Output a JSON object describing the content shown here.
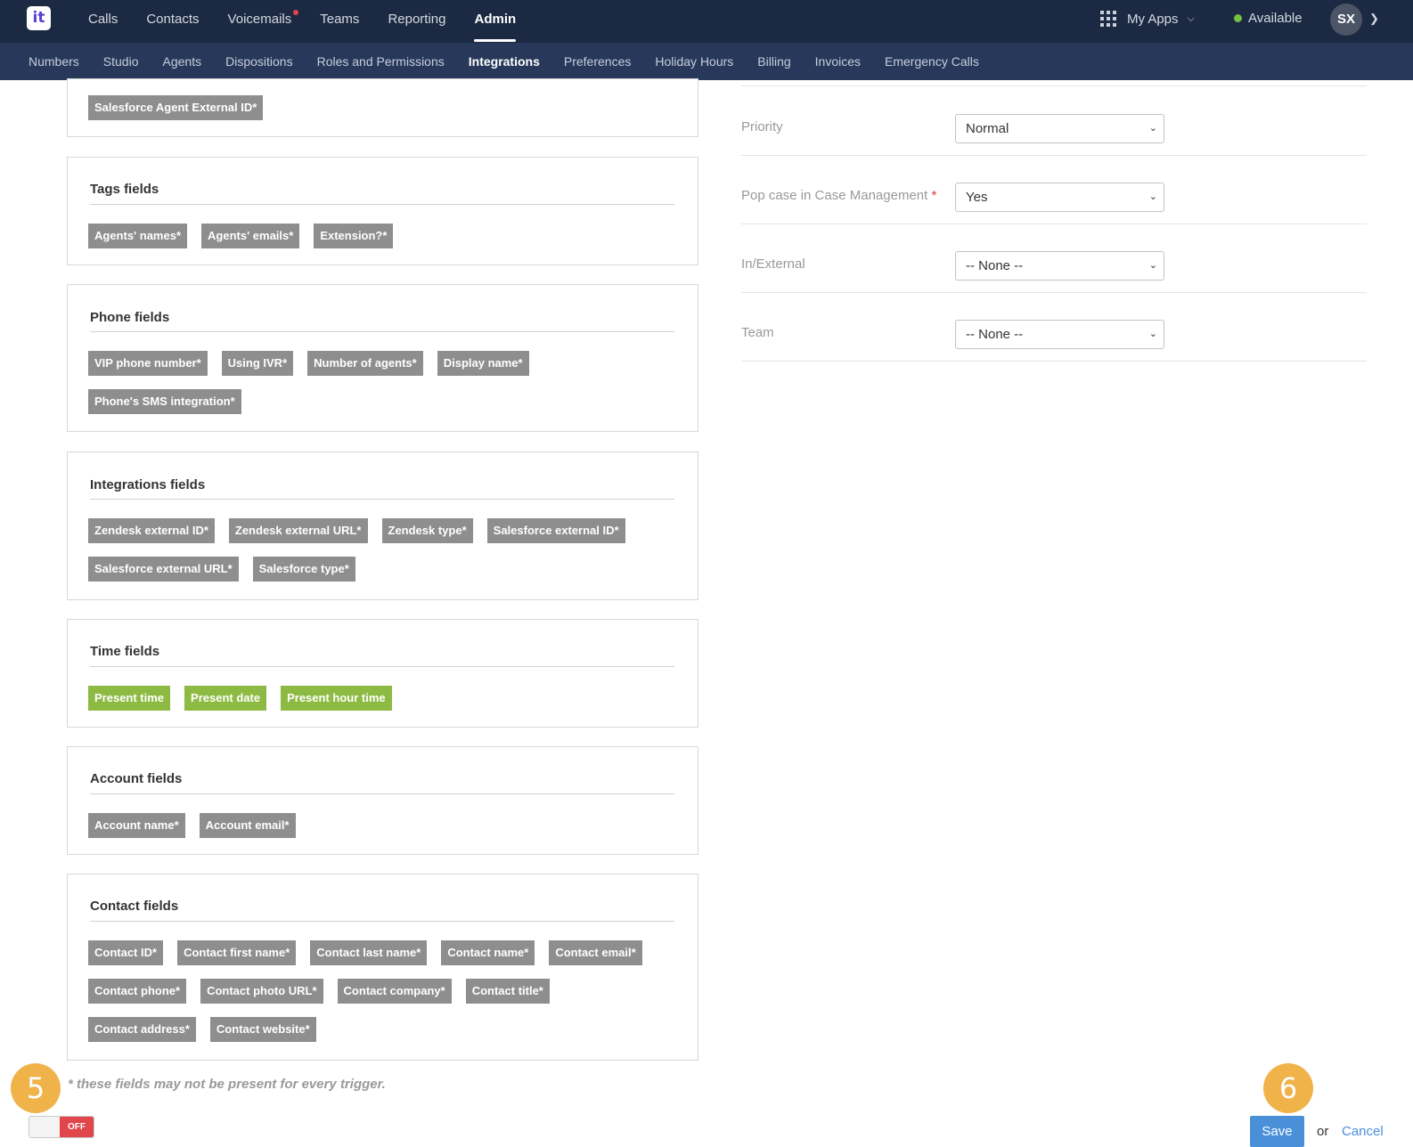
{
  "header": {
    "logo_text": "it",
    "nav": [
      {
        "label": "Calls",
        "active": false
      },
      {
        "label": "Contacts",
        "active": false
      },
      {
        "label": "Voicemails",
        "active": false,
        "has_notification": true
      },
      {
        "label": "Teams",
        "active": false
      },
      {
        "label": "Reporting",
        "active": false
      },
      {
        "label": "Admin",
        "active": true
      }
    ],
    "apps_label": "My Apps",
    "status_label": "Available",
    "status_color": "#74c045",
    "avatar_initials": "SX"
  },
  "subnav": [
    {
      "label": "Numbers",
      "active": false
    },
    {
      "label": "Studio",
      "active": false
    },
    {
      "label": "Agents",
      "active": false
    },
    {
      "label": "Dispositions",
      "active": false
    },
    {
      "label": "Roles and Permissions",
      "active": false
    },
    {
      "label": "Integrations",
      "active": true
    },
    {
      "label": "Preferences",
      "active": false
    },
    {
      "label": "Holiday Hours",
      "active": false
    },
    {
      "label": "Billing",
      "active": false
    },
    {
      "label": "Invoices",
      "active": false
    },
    {
      "label": "Emergency Calls",
      "active": false
    }
  ],
  "panels": {
    "agent": {
      "tags": [
        "Salesforce Agent External ID*"
      ]
    },
    "tags": {
      "title": "Tags fields",
      "tags": [
        "Agents' names*",
        "Agents' emails*",
        "Extension?*"
      ]
    },
    "phone": {
      "title": "Phone fields",
      "tags": [
        "VIP phone number*",
        "Using IVR*",
        "Number of agents*",
        "Display name*",
        "Phone's SMS integration*"
      ]
    },
    "integrations": {
      "title": "Integrations fields",
      "tags": [
        "Zendesk external ID*",
        "Zendesk external URL*",
        "Zendesk type*",
        "Salesforce external ID*",
        "Salesforce external URL*",
        "Salesforce type*"
      ]
    },
    "time": {
      "title": "Time fields",
      "tags": [
        "Present time",
        "Present date",
        "Present hour time"
      ]
    },
    "account": {
      "title": "Account fields",
      "tags": [
        "Account name*",
        "Account email*"
      ]
    },
    "contact": {
      "title": "Contact fields",
      "tags": [
        "Contact ID*",
        "Contact first name*",
        "Contact last name*",
        "Contact name*",
        "Contact email*",
        "Contact phone*",
        "Contact photo URL*",
        "Contact company*",
        "Contact title*",
        "Contact address*",
        "Contact website*"
      ]
    }
  },
  "form": {
    "priority": {
      "label": "Priority",
      "value": "Normal"
    },
    "pop_case": {
      "label": "Pop case in Case Management",
      "required_mark": "*",
      "value": "Yes"
    },
    "in_external": {
      "label": "In/External",
      "value": "-- None --"
    },
    "team": {
      "label": "Team",
      "value": "-- None --"
    }
  },
  "footnote": "* these fields may not be present for every trigger.",
  "toggle": {
    "label": "OFF"
  },
  "badges": {
    "left": "5",
    "right": "6"
  },
  "actions": {
    "save": "Save",
    "or": "or",
    "cancel": "Cancel"
  },
  "colors": {
    "tag_gray": "#8e8e8e",
    "tag_green": "#8dba42",
    "save_blue": "#4a90d9",
    "badge_orange": "#f0b34a",
    "toggle_red": "#e0464c"
  }
}
